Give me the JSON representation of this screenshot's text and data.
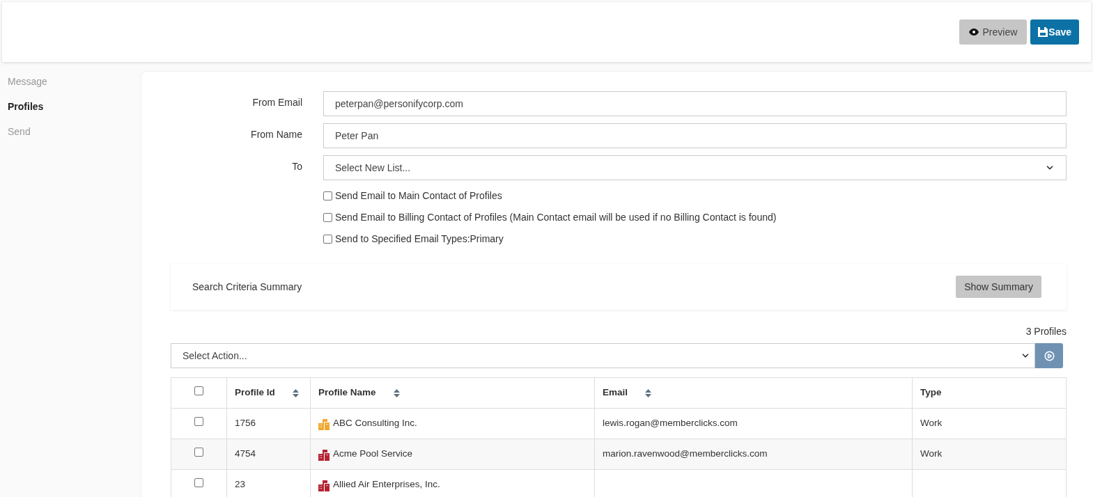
{
  "header": {
    "buttons": [
      {
        "label": "Preview",
        "kind": "preview"
      },
      {
        "label": "Save",
        "kind": "save"
      }
    ]
  },
  "sidebar": {
    "items": [
      {
        "label": "Message",
        "selected": false
      },
      {
        "label": "Profiles",
        "selected": true
      },
      {
        "label": "Send",
        "selected": false
      }
    ]
  },
  "form": {
    "fields": [
      {
        "label": "From Email",
        "kind": "text",
        "value": "peterpan@personifycorp.com"
      },
      {
        "label": "From Name",
        "kind": "text",
        "value": "Peter Pan"
      },
      {
        "label": "To",
        "kind": "select",
        "value": "Select New List..."
      }
    ],
    "options": [
      {
        "label": "Send Email to Main Contact of Profiles",
        "checked": false
      },
      {
        "label": "Send Email to Billing Contact of Profiles (Main Contact email will be used if no Billing Contact is found)",
        "checked": false
      },
      {
        "label": "Send to Specified Email Types:Primary",
        "checked": false
      }
    ]
  },
  "summary": {
    "label": "Search Criteria Summary",
    "button": "Show Summary"
  },
  "count": "3 Profiles",
  "action": {
    "value": "Select Action..."
  },
  "table": {
    "select_all": false,
    "columns": [
      {
        "label": "Profile Id",
        "sortable": true
      },
      {
        "label": "Profile Name",
        "sortable": true
      },
      {
        "label": "Email",
        "sortable": true
      },
      {
        "label": "Type",
        "sortable": false
      }
    ],
    "rows": [
      {
        "checked": false,
        "id": "1756",
        "name": "ABC Consulting Inc.",
        "color": "#f0a830",
        "email": "lewis.rogan@memberclicks.com",
        "type": "Work"
      },
      {
        "checked": false,
        "id": "4754",
        "name": "Acme Pool Service",
        "color": "#b52332",
        "email": "marion.ravenwood@memberclicks.com",
        "type": "Work"
      },
      {
        "checked": false,
        "id": "23",
        "name": "Allied Air Enterprises, Inc.",
        "color": "#b52332"
      }
    ]
  }
}
